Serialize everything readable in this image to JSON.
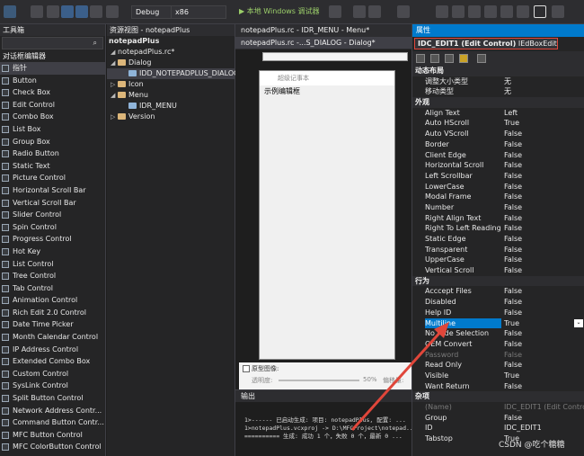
{
  "toolbar": {
    "config": "Debug",
    "platform": "x86",
    "run_label": "▶ 本地 Windows 调试器"
  },
  "toolbox": {
    "title": "工具箱",
    "section": "对话框编辑器",
    "items": [
      "指针",
      "Button",
      "Check Box",
      "Edit Control",
      "Combo Box",
      "List Box",
      "Group Box",
      "Radio Button",
      "Static Text",
      "Picture Control",
      "Horizontal Scroll Bar",
      "Vertical Scroll Bar",
      "Slider Control",
      "Spin Control",
      "Progress Control",
      "Hot Key",
      "List Control",
      "Tree Control",
      "Tab Control",
      "Animation Control",
      "Rich Edit 2.0 Control",
      "Date Time Picker",
      "Month Calendar Control",
      "IP Address Control",
      "Extended Combo Box",
      "Custom Control",
      "SysLink Control",
      "Split Button Control",
      "Network Address Contr...",
      "Command Button Contr...",
      "MFC Button Control",
      "MFC ColorButton Control"
    ]
  },
  "resview": {
    "title": "资源视图 - notepadPlus",
    "tree": [
      "notepadPlus",
      "notepadPlus.rc*",
      "Dialog",
      "IDD_NOTEPADPLUS_DIALOG",
      "Icon",
      "Menu",
      "IDR_MENU",
      "Version"
    ]
  },
  "tabs": {
    "tab1": "notepadPlus.rc - IDR_MENU - Menu*",
    "tab2": "notepadPlus.rc -...S_DIALOG - Dialog*"
  },
  "dialog": {
    "title": "超级记事本",
    "edit_text": "示例编辑框",
    "prototype_label": "原型图像:",
    "transparency": "透明度:",
    "percent": "50%",
    "pos": "偏移量:"
  },
  "output": {
    "title": "输出",
    "lines": [
      "1>------ 已启动生成: 项目: notepadPlus, 配置: ...",
      "1>notepadPlus.vcxproj -> D:\\MFCProject\\notepad...",
      "========== 生成: 成功 1 个，失败 0 个，最新 0 ..."
    ]
  },
  "props": {
    "title": "属性",
    "object": "IDC_EDIT1 (Edit Control)",
    "object_type": "IEdBoxEditor",
    "categories": [
      {
        "name": "动态布局",
        "rows": [
          [
            "调整大小类型",
            "无"
          ],
          [
            "移动类型",
            "无"
          ]
        ]
      },
      {
        "name": "外观",
        "rows": [
          [
            "Align Text",
            "Left"
          ],
          [
            "Auto HScroll",
            "True"
          ],
          [
            "Auto VScroll",
            "False"
          ],
          [
            "Border",
            "False"
          ],
          [
            "Client Edge",
            "False"
          ],
          [
            "Horizontal Scroll",
            "False"
          ],
          [
            "Left Scrollbar",
            "False"
          ],
          [
            "LowerCase",
            "False"
          ],
          [
            "Modal Frame",
            "False"
          ],
          [
            "Number",
            "False"
          ],
          [
            "Right Align Text",
            "False"
          ],
          [
            "Right To Left Reading C",
            "False"
          ],
          [
            "Static Edge",
            "False"
          ],
          [
            "Transparent",
            "False"
          ],
          [
            "UpperCase",
            "False"
          ],
          [
            "Vertical Scroll",
            "False"
          ]
        ]
      },
      {
        "name": "行为",
        "rows": [
          [
            "Acccept Files",
            "False"
          ],
          [
            "Disabled",
            "False"
          ],
          [
            "Help ID",
            "False"
          ],
          [
            "Multiline",
            "True"
          ],
          [
            "No Hide Selection",
            "False"
          ],
          [
            "OEM Convert",
            "False"
          ],
          [
            "Password",
            "False"
          ],
          [
            "Read Only",
            "False"
          ],
          [
            "Visible",
            "True"
          ],
          [
            "Want Return",
            "False"
          ]
        ]
      },
      {
        "name": "杂项",
        "rows": [
          [
            "(Name)",
            "IDC_EDIT1 (Edit Control)"
          ],
          [
            "Group",
            "False"
          ],
          [
            "ID",
            "IDC_EDIT1"
          ],
          [
            "Tabstop",
            "True"
          ]
        ]
      }
    ]
  },
  "watermark": "CSDN @吃个糖糖",
  "colors": {
    "accent": "#007acc",
    "highlight": "#e0463a"
  }
}
